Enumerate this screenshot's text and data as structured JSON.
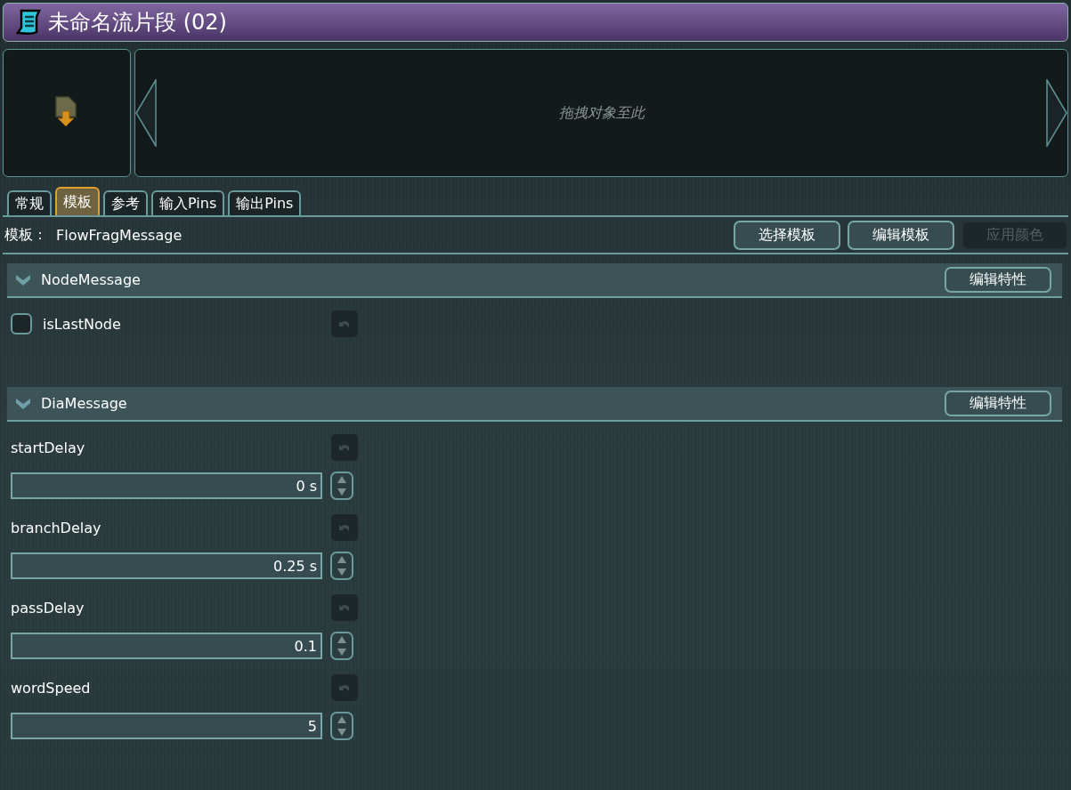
{
  "window": {
    "title": "未命名流片段 (02)"
  },
  "drop_zone": {
    "hint": "拖拽对象至此"
  },
  "tabs": [
    {
      "label": "常规",
      "selected": false
    },
    {
      "label": "模板",
      "selected": true
    },
    {
      "label": "参考",
      "selected": false
    },
    {
      "label": "输入Pins",
      "selected": false
    },
    {
      "label": "输出Pins",
      "selected": false
    }
  ],
  "template": {
    "label": "模板：",
    "value": "FlowFragMessage"
  },
  "buttons": [
    {
      "label": "选择模板",
      "disabled": false
    },
    {
      "label": "编辑模板",
      "disabled": false
    },
    {
      "label": "应用颜色",
      "disabled": true
    }
  ],
  "sections": [
    {
      "name": "NodeMessage",
      "expanded": true,
      "button": "编辑特性",
      "properties": [
        {
          "kind": "checkbox",
          "label": "isLastNode",
          "checked": false
        }
      ]
    },
    {
      "name": "DiaMessage",
      "expanded": true,
      "button": "编辑特性",
      "properties": [
        {
          "kind": "number",
          "label": "startDelay",
          "value": "0 s"
        },
        {
          "kind": "number",
          "label": "branchDelay",
          "value": "0.25 s"
        },
        {
          "kind": "number",
          "label": "passDelay",
          "value": "0.1"
        },
        {
          "kind": "number",
          "label": "wordSpeed",
          "value": "5"
        }
      ]
    }
  ]
}
